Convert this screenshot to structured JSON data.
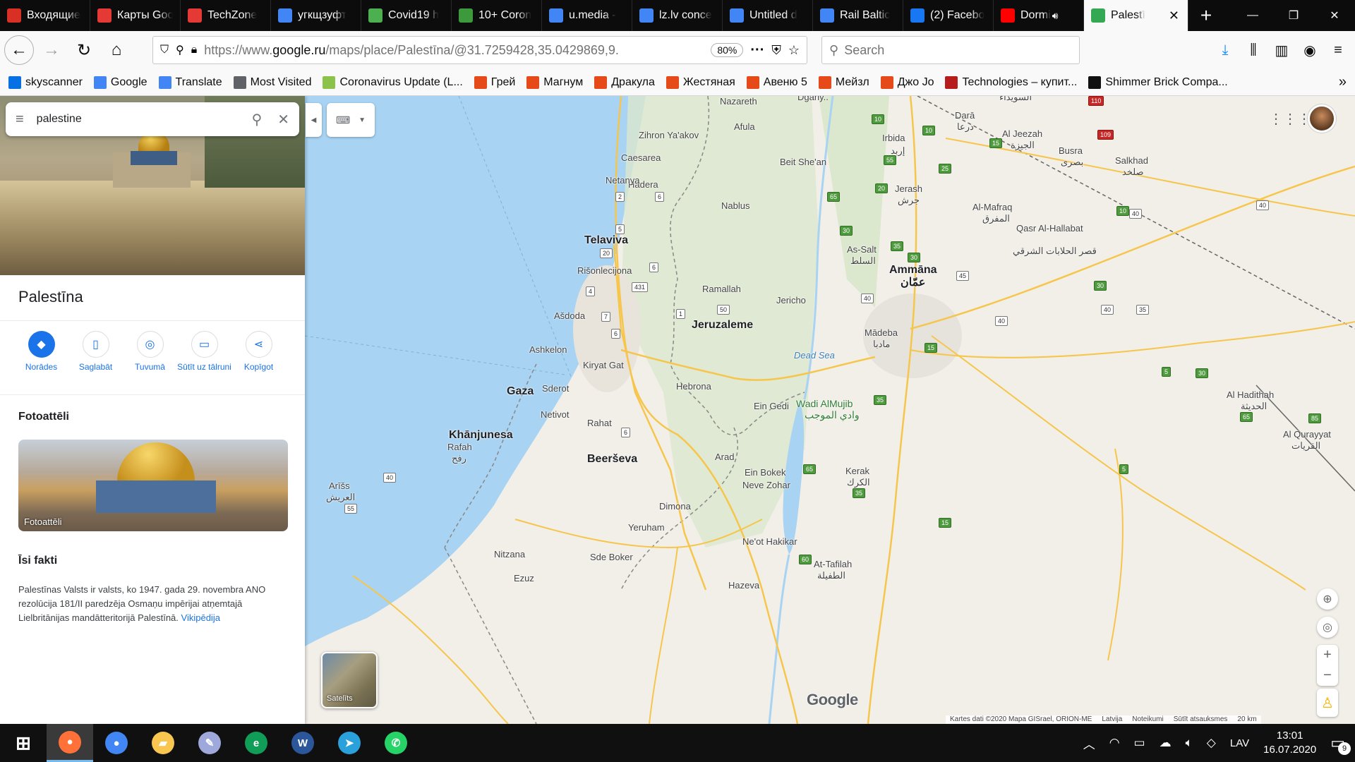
{
  "tabs": [
    {
      "label": "Входящие",
      "icon": "gmail-icon",
      "color": "#d93025"
    },
    {
      "label": "Карты Google",
      "icon": "yandex-maps-icon",
      "color": "#e53935"
    },
    {
      "label": "TechZone",
      "icon": "techzone-icon",
      "color": "#e53935"
    },
    {
      "label": "угкщзуфт",
      "icon": "google-icon",
      "color": "#4285f4"
    },
    {
      "label": "Covid19 h",
      "icon": "download-icon",
      "color": "#4caf50"
    },
    {
      "label": "10+ Coron",
      "icon": "plc-icon",
      "color": "#3c9a3c"
    },
    {
      "label": "u.media -",
      "icon": "docs-icon",
      "color": "#4285f4"
    },
    {
      "label": "lz.lv conce",
      "icon": "docs-icon",
      "color": "#4285f4"
    },
    {
      "label": "Untitled d",
      "icon": "docs-icon",
      "color": "#4285f4"
    },
    {
      "label": "Rail Baltic",
      "icon": "google-icon",
      "color": "#4285f4"
    },
    {
      "label": "(2) Facebo",
      "icon": "facebook-icon",
      "color": "#1877f2"
    },
    {
      "label": "Dormi",
      "icon": "youtube-icon",
      "color": "#ff0000"
    },
    {
      "label": "Palestī",
      "icon": "google-maps-icon",
      "color": "#34a853",
      "active": true
    }
  ],
  "navbar": {
    "url_prefix": "https://www.",
    "url_host": "google.ru",
    "url_path": "/maps/place/Palestīna/@31.7259428,35.0429869,9.",
    "zoom": "80%",
    "search_placeholder": "Search"
  },
  "bookmarks": [
    {
      "label": "skyscanner",
      "icon": "skyscanner-icon",
      "color": "#0770e3"
    },
    {
      "label": "Google",
      "icon": "google-icon",
      "color": "#4285f4"
    },
    {
      "label": "Translate",
      "icon": "translate-icon",
      "color": "#4285f4"
    },
    {
      "label": "Most Visited",
      "icon": "gear-icon",
      "color": "#5f6368"
    },
    {
      "label": "Coronavirus Update (L...",
      "icon": "worldometer-icon",
      "color": "#8bc34a"
    },
    {
      "label": "Грей",
      "icon": "flame-icon",
      "color": "#e64a19"
    },
    {
      "label": "Магнум",
      "icon": "flame-icon",
      "color": "#e64a19"
    },
    {
      "label": "Дракула",
      "icon": "flame-icon",
      "color": "#e64a19"
    },
    {
      "label": "Жестяная",
      "icon": "flame-icon",
      "color": "#e64a19"
    },
    {
      "label": "Авеню 5",
      "icon": "flame-icon",
      "color": "#e64a19"
    },
    {
      "label": "Мейзл",
      "icon": "flame-icon",
      "color": "#e64a19"
    },
    {
      "label": "Джо Jo",
      "icon": "flame-icon",
      "color": "#e64a19"
    },
    {
      "label": "Technologies – купит...",
      "icon": "technologies-icon",
      "color": "#b71c1c"
    },
    {
      "label": "Shimmer Brick Compa...",
      "icon": "bb-icon",
      "color": "#111111"
    }
  ],
  "sidebar": {
    "search_value": "palestine",
    "title": "Palestīna",
    "actions": [
      {
        "label": "Norādes",
        "icon": "directions-icon",
        "glyph": "◆"
      },
      {
        "label": "Saglabāt",
        "icon": "bookmark-icon",
        "glyph": "▯"
      },
      {
        "label": "Tuvumā",
        "icon": "nearby-icon",
        "glyph": "◎"
      },
      {
        "label": "Sūtīt uz tālruni",
        "icon": "send-to-phone-icon",
        "glyph": "▭"
      },
      {
        "label": "Kopīgot",
        "icon": "share-icon",
        "glyph": "⋖"
      }
    ],
    "photos_heading": "Fotoattēli",
    "photo_label": "Fotoattēli",
    "facts_heading": "Īsi fakti",
    "facts_text": "Palestīnas Valsts ir valsts, ko 1947. gada 29. novembra ANO rezolūcija 181/II paredzēja Osmaņu impērijai atņemtajā Lielbritānijas mandātteritorijā Palestīnā.",
    "facts_link": "Vikipēdija"
  },
  "map": {
    "satellite_label": "Satelīts",
    "google_logo": "Google",
    "attribution": [
      "Kartes dati ©2020 Mapa GISrael, ORION-ME",
      "Latvija",
      "Noteikumi",
      "Sūtīt atsauksmes",
      "20 km"
    ],
    "labels": [
      {
        "text": "Nazareth",
        "id": "nazareth",
        "cls": ""
      },
      {
        "text": "Afula",
        "id": "afula",
        "cls": ""
      },
      {
        "text": "Zihron Ya'akov",
        "id": "zihron",
        "cls": ""
      },
      {
        "text": "Caesarea",
        "id": "caesarea",
        "cls": ""
      },
      {
        "text": "Hadera",
        "id": "hadera",
        "cls": ""
      },
      {
        "text": "Beit She'an",
        "id": "beitshean",
        "cls": ""
      },
      {
        "text": "Irbida",
        "id": "irbida",
        "cls": ""
      },
      {
        "text": "إربد",
        "id": "irbida-ar",
        "cls": ""
      },
      {
        "text": "Darā",
        "id": "dara",
        "cls": ""
      },
      {
        "text": "درعا",
        "id": "dara-ar",
        "cls": ""
      },
      {
        "text": "Al Jeezah",
        "id": "aljeezah",
        "cls": ""
      },
      {
        "text": "الجيزة",
        "id": "aljeezah-ar",
        "cls": ""
      },
      {
        "text": "Busra",
        "id": "busra",
        "cls": ""
      },
      {
        "text": "بصرى",
        "id": "busra-ar",
        "cls": ""
      },
      {
        "text": "Salkhad",
        "id": "salkhad",
        "cls": ""
      },
      {
        "text": "صلخد",
        "id": "salkhad-ar",
        "cls": ""
      },
      {
        "text": "Al-Mafraq",
        "id": "almafraq",
        "cls": ""
      },
      {
        "text": "المفرق",
        "id": "almafraq-ar",
        "cls": ""
      },
      {
        "text": "Netanya",
        "id": "netanya",
        "cls": ""
      },
      {
        "text": "Nablus",
        "id": "nablus",
        "cls": ""
      },
      {
        "text": "Jerash",
        "id": "jerash",
        "cls": ""
      },
      {
        "text": "جرش",
        "id": "jerash-ar",
        "cls": ""
      },
      {
        "text": "Telaviva",
        "id": "telaviva",
        "cls": "big"
      },
      {
        "text": "Qasr Al-Hallabat",
        "id": "qasr",
        "cls": ""
      },
      {
        "text": "قصر الحلابات الشرقي",
        "id": "qasr-ar",
        "cls": ""
      },
      {
        "text": "As-Salt",
        "id": "assalt",
        "cls": ""
      },
      {
        "text": "السلط",
        "id": "assalt-ar",
        "cls": ""
      },
      {
        "text": "Ammāna",
        "id": "ammana",
        "cls": "big"
      },
      {
        "text": "عمّان",
        "id": "ammana-ar",
        "cls": "big"
      },
      {
        "text": "Rišonlecijona",
        "id": "rishon",
        "cls": ""
      },
      {
        "text": "Ramallah",
        "id": "ramallah",
        "cls": ""
      },
      {
        "text": "Jericho",
        "id": "jericho",
        "cls": ""
      },
      {
        "text": "Ašdoda",
        "id": "ashdoda",
        "cls": ""
      },
      {
        "text": "Jeruzaleme",
        "id": "jeruzaleme",
        "cls": "big"
      },
      {
        "text": "Mādeba",
        "id": "madeba",
        "cls": ""
      },
      {
        "text": "مادبا",
        "id": "madeba-ar",
        "cls": ""
      },
      {
        "text": "Ashkelon",
        "id": "ashkelon",
        "cls": ""
      },
      {
        "text": "Kiryat Gat",
        "id": "kiryatgat",
        "cls": ""
      },
      {
        "text": "Hebrona",
        "id": "hebrona",
        "cls": ""
      },
      {
        "text": "Dead Sea",
        "id": "deadsea",
        "cls": "water"
      },
      {
        "text": "Gaza",
        "id": "gaza",
        "cls": "big"
      },
      {
        "text": "Sderot",
        "id": "sderot",
        "cls": ""
      },
      {
        "text": "Wadi AlMujib",
        "id": "wadialmujib",
        "cls": "park"
      },
      {
        "text": "وادي الموجب",
        "id": "wadialmujib-ar",
        "cls": "park"
      },
      {
        "text": "Ein Gedi",
        "id": "eingedi",
        "cls": ""
      },
      {
        "text": "Al Hadithah",
        "id": "alhadithah",
        "cls": ""
      },
      {
        "text": "الحديثة",
        "id": "alhadithah-ar",
        "cls": ""
      },
      {
        "text": "Netivot",
        "id": "netivot",
        "cls": ""
      },
      {
        "text": "Rahat",
        "id": "rahat",
        "cls": ""
      },
      {
        "text": "Khānjunesa",
        "id": "khanjunesa",
        "cls": "big"
      },
      {
        "text": "Al Qurayyat",
        "id": "alqurayyat",
        "cls": ""
      },
      {
        "text": "القريات",
        "id": "alqurayyat-ar",
        "cls": ""
      },
      {
        "text": "Rafah",
        "id": "rafah",
        "cls": ""
      },
      {
        "text": "رفح",
        "id": "rafah-ar",
        "cls": ""
      },
      {
        "text": "Arad",
        "id": "arad",
        "cls": ""
      },
      {
        "text": "Beerševa",
        "id": "beersheva",
        "cls": "big"
      },
      {
        "text": "Ein Bokek",
        "id": "einbokek",
        "cls": ""
      },
      {
        "text": "Neve Zohar",
        "id": "nevezohar",
        "cls": ""
      },
      {
        "text": "Kerak",
        "id": "kerak",
        "cls": ""
      },
      {
        "text": "الكرك",
        "id": "kerak-ar",
        "cls": ""
      },
      {
        "text": "Arīšs",
        "id": "arish",
        "cls": ""
      },
      {
        "text": "العريش",
        "id": "arish-ar",
        "cls": ""
      },
      {
        "text": "Dimona",
        "id": "dimona",
        "cls": ""
      },
      {
        "text": "Yeruham",
        "id": "yeruham",
        "cls": ""
      },
      {
        "text": "Ne'ot Hakikar",
        "id": "neothakikar",
        "cls": ""
      },
      {
        "text": "Nitzana",
        "id": "nitzana",
        "cls": ""
      },
      {
        "text": "Sde Boker",
        "id": "sdeboker",
        "cls": ""
      },
      {
        "text": "At-Tafilah",
        "id": "attafilah",
        "cls": ""
      },
      {
        "text": "الطفيلة",
        "id": "attafilah-ar",
        "cls": ""
      },
      {
        "text": "Ezuz",
        "id": "ezuz",
        "cls": ""
      },
      {
        "text": "Hazeva",
        "id": "hazeva",
        "cls": ""
      },
      {
        "text": "السويداء",
        "id": "suwayda-ar",
        "cls": ""
      },
      {
        "text": "Dgany..",
        "id": "dgany",
        "cls": ""
      }
    ],
    "shields": [
      {
        "text": "2",
        "id": "s2",
        "cls": ""
      },
      {
        "text": "6",
        "id": "s6a",
        "cls": ""
      },
      {
        "text": "5",
        "id": "s5",
        "cls": ""
      },
      {
        "text": "20",
        "id": "s20",
        "cls": ""
      },
      {
        "text": "6",
        "id": "s6b",
        "cls": ""
      },
      {
        "text": "4",
        "id": "s4",
        "cls": ""
      },
      {
        "text": "431",
        "id": "s431",
        "cls": ""
      },
      {
        "text": "7",
        "id": "s7",
        "cls": ""
      },
      {
        "text": "1",
        "id": "s1",
        "cls": ""
      },
      {
        "text": "50",
        "id": "s50",
        "cls": ""
      },
      {
        "text": "6",
        "id": "s6c",
        "cls": ""
      },
      {
        "text": "6",
        "id": "s6d",
        "cls": ""
      },
      {
        "text": "40",
        "id": "s40a",
        "cls": ""
      },
      {
        "text": "55",
        "id": "s55",
        "cls": ""
      },
      {
        "text": "10",
        "id": "s10a",
        "cls": "green"
      },
      {
        "text": "10",
        "id": "s10b",
        "cls": "green"
      },
      {
        "text": "15",
        "id": "s15a",
        "cls": "green"
      },
      {
        "text": "25",
        "id": "s25",
        "cls": "green"
      },
      {
        "text": "55",
        "id": "s55b",
        "cls": "green"
      },
      {
        "text": "20",
        "id": "s20b",
        "cls": "green"
      },
      {
        "text": "65",
        "id": "s65a",
        "cls": "green"
      },
      {
        "text": "10",
        "id": "s10c",
        "cls": "green"
      },
      {
        "text": "30",
        "id": "s30a",
        "cls": "green"
      },
      {
        "text": "35",
        "id": "s35a",
        "cls": "green"
      },
      {
        "text": "30",
        "id": "s30b",
        "cls": "green"
      },
      {
        "text": "45",
        "id": "s45",
        "cls": ""
      },
      {
        "text": "40",
        "id": "s40b",
        "cls": ""
      },
      {
        "text": "40",
        "id": "s40c",
        "cls": ""
      },
      {
        "text": "35",
        "id": "s35b",
        "cls": ""
      },
      {
        "text": "40",
        "id": "s40d",
        "cls": ""
      },
      {
        "text": "30",
        "id": "s30c",
        "cls": "green"
      },
      {
        "text": "15",
        "id": "s15b",
        "cls": "green"
      },
      {
        "text": "35",
        "id": "s35c",
        "cls": "green"
      },
      {
        "text": "5",
        "id": "s5b",
        "cls": "green"
      },
      {
        "text": "30",
        "id": "s30d",
        "cls": "green"
      },
      {
        "text": "65",
        "id": "s65b",
        "cls": "green"
      },
      {
        "text": "85",
        "id": "s85",
        "cls": "green"
      },
      {
        "text": "5",
        "id": "s5c",
        "cls": "green"
      },
      {
        "text": "65",
        "id": "s65c",
        "cls": "green"
      },
      {
        "text": "35",
        "id": "s35d",
        "cls": "green"
      },
      {
        "text": "15",
        "id": "s15c",
        "cls": "green"
      },
      {
        "text": "60",
        "id": "s60",
        "cls": "green"
      },
      {
        "text": "40",
        "id": "s40e",
        "cls": ""
      },
      {
        "text": "40",
        "id": "s40f",
        "cls": ""
      },
      {
        "text": "110",
        "id": "s110",
        "cls": "red"
      },
      {
        "text": "109",
        "id": "s109",
        "cls": "red"
      }
    ]
  },
  "taskbar": {
    "apps": [
      {
        "name": "windows-start-icon",
        "glyph": "⊞",
        "color": "#ffffff"
      },
      {
        "name": "firefox-icon",
        "glyph": "●",
        "color": "#ff7139",
        "active": true
      },
      {
        "name": "chrome-icon",
        "glyph": "●",
        "color": "#4285f4"
      },
      {
        "name": "file-explorer-icon",
        "glyph": "▰",
        "color": "#f9c74f"
      },
      {
        "name": "notepad-app-icon",
        "glyph": "✎",
        "color": "#9fa8da"
      },
      {
        "name": "edge-icon",
        "glyph": "e",
        "color": "#0f9d58"
      },
      {
        "name": "word-icon",
        "glyph": "W",
        "color": "#2b579a"
      },
      {
        "name": "telegram-icon",
        "glyph": "➤",
        "color": "#2aa1da"
      },
      {
        "name": "whatsapp-icon",
        "glyph": "✆",
        "color": "#25d366"
      }
    ],
    "language": "LAV",
    "time": "13:01",
    "date": "16.07.2020",
    "notifications": "9"
  }
}
